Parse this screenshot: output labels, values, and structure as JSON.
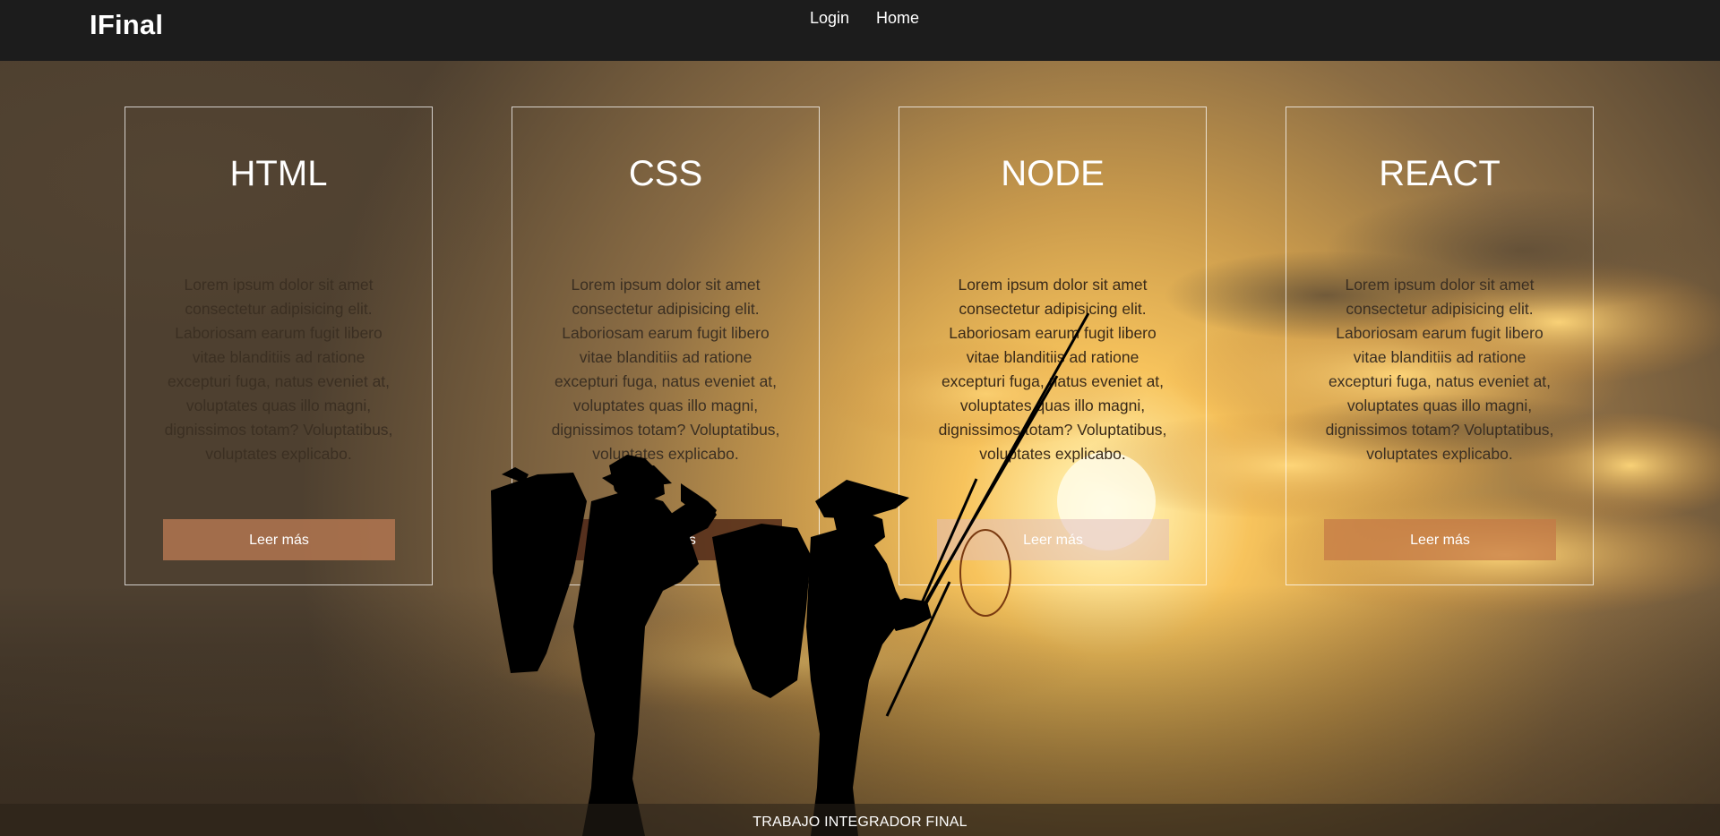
{
  "navbar": {
    "brand": "IFinal",
    "links": [
      {
        "label": "Login"
      },
      {
        "label": "Home"
      }
    ]
  },
  "cards": [
    {
      "title": "HTML",
      "text": "Lorem ipsum dolor sit amet consectetur adipisicing elit. Laboriosam earum fugit libero vitae blanditiis ad ratione excepturi fuga, natus eveniet at, voluptates quas illo magni, dignissimos totam? Voluptatibus, voluptates explicabo.",
      "button": "Leer más"
    },
    {
      "title": "CSS",
      "text": "Lorem ipsum dolor sit amet consectetur adipisicing elit. Laboriosam earum fugit libero vitae blanditiis ad ratione excepturi fuga, natus eveniet at, voluptates quas illo magni, dignissimos totam? Voluptatibus, voluptates explicabo.",
      "button": "Leer más"
    },
    {
      "title": "NODE",
      "text": "Lorem ipsum dolor sit amet consectetur adipisicing elit. Laboriosam earum fugit libero vitae blanditiis ad ratione excepturi fuga, natus eveniet at, voluptates quas illo magni, dignissimos totam? Voluptatibus, voluptates explicabo.",
      "button": "Leer más"
    },
    {
      "title": "REACT",
      "text": "Lorem ipsum dolor sit amet consectetur adipisicing elit. Laboriosam earum fugit libero vitae blanditiis ad ratione excepturi fuga, natus eveniet at, voluptates quas illo magni, dignissimos totam? Voluptatibus, voluptates explicabo.",
      "button": "Leer más"
    }
  ],
  "footer": {
    "text": "TRABAJO INTEGRADOR FINAL"
  },
  "colors": {
    "navbar": "#1c1c1c",
    "sky_dark": "#5a4a32",
    "sun": "#fff4c8",
    "silhouette": "#000000"
  }
}
